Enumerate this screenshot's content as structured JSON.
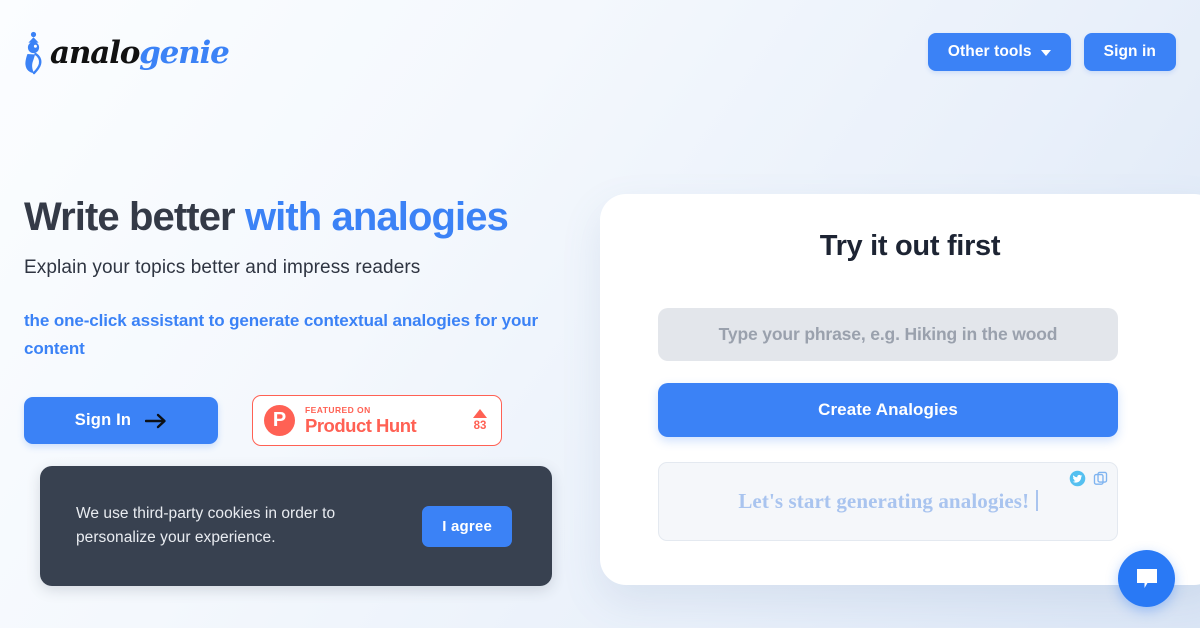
{
  "brand": {
    "logo_text_dark": "analo",
    "logo_text_blue": "genie",
    "accent_blue": "#3b82f6",
    "dark_navy": "#384150",
    "product_hunt_color": "#ff6154"
  },
  "header": {
    "other_tools_label": "Other tools",
    "sign_in_label": "Sign in"
  },
  "hero": {
    "headline_dark": "Write better",
    "headline_accent": "with analogies",
    "subtitle": "Explain your topics better and impress readers",
    "tagline": "the one-click assistant to generate contextual analogies for your content",
    "sign_in_label": "Sign In"
  },
  "product_hunt": {
    "featured_label": "FEATURED ON",
    "name": "Product Hunt",
    "upvotes": "83",
    "logo_letter": "P"
  },
  "cookie": {
    "message": "We use third-party cookies in order to personalize your experience.",
    "agree_label": "I agree"
  },
  "trial_card": {
    "title": "Try it out first",
    "input_value": "",
    "input_placeholder": "Type your phrase, e.g. Hiking in the wood",
    "create_label": "Create Analogies",
    "result_text": "Let's start generating analogies!",
    "twitter_icon": "twitter-icon",
    "copy_icon": "copy-icon"
  },
  "chat": {
    "icon": "chat-bubble-icon"
  }
}
